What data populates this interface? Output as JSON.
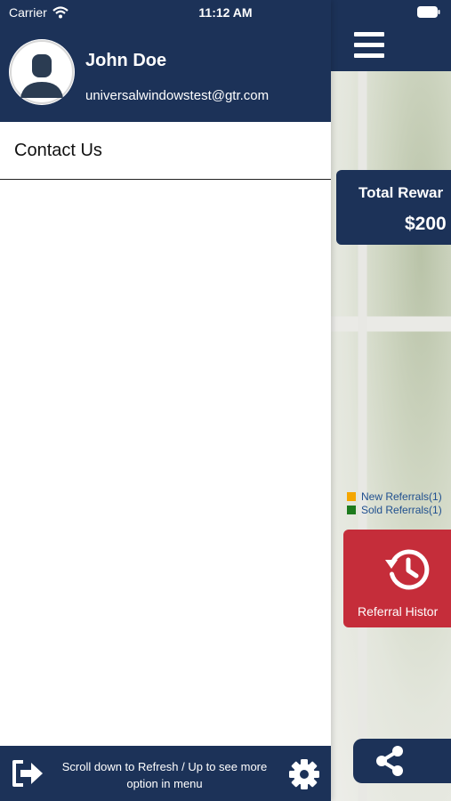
{
  "status_bar": {
    "carrier": "Carrier",
    "time": "11:12 AM",
    "icons": [
      "wifi-icon",
      "battery-icon"
    ]
  },
  "drawer": {
    "user_name": "John Doe",
    "user_email": "universalwindowstest@gtr.com",
    "avatar_icon": "user-avatar-icon",
    "menu_items": [
      {
        "label": "Contact Us"
      }
    ],
    "footer": {
      "hint_text": "Scroll down to Refresh / Up to see more option in menu",
      "logout_icon": "logout-icon",
      "settings_icon": "gear-icon"
    }
  },
  "background_app": {
    "menu_icon": "hamburger-icon",
    "rewards_title": "Total Rewar",
    "rewards_amount": "$200",
    "legend": [
      {
        "label": "New Referrals(1)",
        "color": "#f5a600"
      },
      {
        "label": "Sold Referrals(1)",
        "color": "#1d7a1d"
      }
    ],
    "history_label": "Referral Histor",
    "history_icon": "history-icon",
    "share_icon": "share-icon"
  },
  "colors": {
    "navy": "#1c3258",
    "red": "#c52d3a",
    "white": "#ffffff"
  }
}
